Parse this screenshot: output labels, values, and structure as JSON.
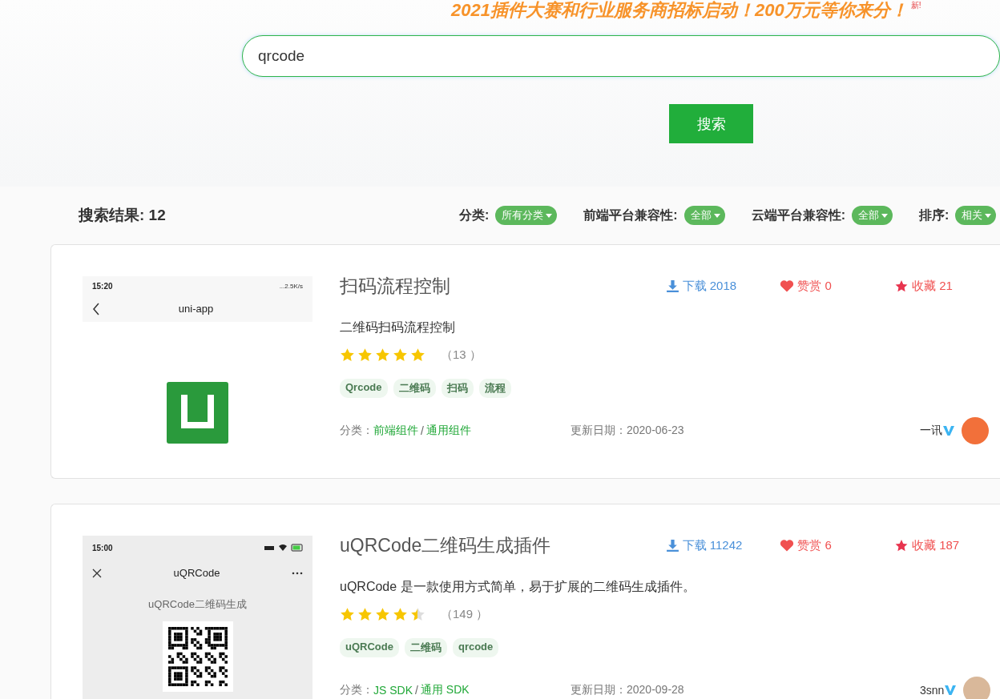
{
  "banner": {
    "text": "2021插件大赛和行业服务商招标启动！200万元等你来分！",
    "badge": "新!"
  },
  "search": {
    "value": "qrcode",
    "button": "搜索"
  },
  "results": {
    "label": "搜索结果: 12"
  },
  "filters": [
    {
      "label": "分类:",
      "value": "所有分类"
    },
    {
      "label": "前端平台兼容性:",
      "value": "全部"
    },
    {
      "label": "云端平台兼容性:",
      "value": "全部"
    },
    {
      "label": "排序:",
      "value": "相关"
    }
  ],
  "plugins": [
    {
      "title": "扫码流程控制",
      "description": "二维码扫码流程控制",
      "downloads": "下载 2018",
      "likes": "赞赏 0",
      "favorites": "收藏 21",
      "stars": 5,
      "rating_count": "（13 ）",
      "tags": [
        "Qrcode",
        "二维码",
        "扫码",
        "流程"
      ],
      "category_label": "分类：",
      "categories": [
        "前端组件",
        "通用组件"
      ],
      "category_separator": "/",
      "updated": "更新日期：2020-06-23",
      "author": "一讯",
      "verified": true,
      "thumbnail": {
        "kind": "app-screen",
        "time": "15:20",
        "status": "...2.5K/s",
        "title": "uni-app"
      }
    },
    {
      "title": "uQRCode二维码生成插件",
      "description": "uQRCode 是一款使用方式简单，易于扩展的二维码生成插件。",
      "downloads": "下载 11242",
      "likes": "赞赏 6",
      "favorites": "收藏 187",
      "stars": 4.5,
      "rating_count": "（149 ）",
      "tags": [
        "uQRCode",
        "二维码",
        "qrcode"
      ],
      "category_label": "分类：",
      "categories": [
        "JS SDK",
        "通用 SDK"
      ],
      "category_separator": "/",
      "updated": "更新日期：2020-09-28",
      "author": "3snn",
      "verified": true,
      "thumbnail": {
        "kind": "qr-demo",
        "time": "15:00",
        "title": "uQRCode",
        "caption": "uQRCode二维码生成"
      }
    }
  ]
}
